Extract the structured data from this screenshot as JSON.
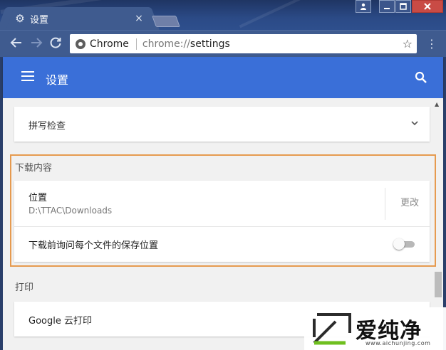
{
  "window": {
    "tab": {
      "title": "设置",
      "icon": "gear-icon",
      "close_icon": "close-icon"
    },
    "controls": {
      "user_icon": "user-icon",
      "minimize_icon": "minimize-icon",
      "maximize_icon": "maximize-icon",
      "close_icon": "close-icon",
      "close_color": "#c94b45"
    }
  },
  "toolbar": {
    "back_icon": "back-arrow-icon",
    "forward_icon": "forward-arrow-icon",
    "reload_icon": "reload-icon",
    "site_name": "Chrome",
    "url_scheme": "chrome://",
    "url_path": "settings",
    "star_icon": "star-icon",
    "menu_icon": "more-vert-icon"
  },
  "header": {
    "title": "设置",
    "menu_icon": "hamburger-icon",
    "search_icon": "search-icon",
    "color": "#3a6fd8"
  },
  "settings": {
    "spellcheck": {
      "label": "拼写检查",
      "expand_icon": "chevron-down-icon"
    },
    "downloads": {
      "section_title": "下载内容",
      "location_label": "位置",
      "location_path": "D:\\TTAC\\Downloads",
      "change_button": "更改",
      "ask_label": "下载前询问每个文件的保存位置",
      "ask_enabled": false,
      "highlight_color": "#e69a4f"
    },
    "printing": {
      "section_title": "打印",
      "cloud_print_label": "Google 云打印"
    }
  },
  "watermark": {
    "brand": "爱纯净",
    "url": "www.aichunjing.com"
  }
}
